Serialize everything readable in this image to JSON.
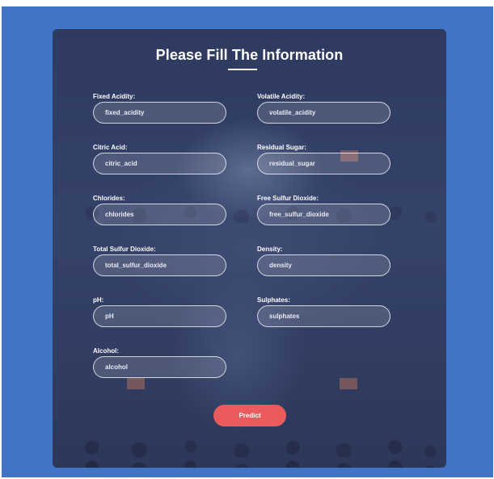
{
  "form": {
    "title": "Please Fill The Information",
    "submit_label": "Predict",
    "fields": [
      {
        "label": "Fixed Acidity:",
        "placeholder": "fixed_acidity"
      },
      {
        "label": "Volatile Acidity:",
        "placeholder": "volatile_acidity"
      },
      {
        "label": "Citric Acid:",
        "placeholder": "citric_acid"
      },
      {
        "label": "Residual Sugar:",
        "placeholder": "residual_sugar"
      },
      {
        "label": "Chlorides:",
        "placeholder": "chlorides"
      },
      {
        "label": "Free Sulfur Dioxide:",
        "placeholder": "free_sulfur_dioxide"
      },
      {
        "label": "Total Sulfur Dioxide:",
        "placeholder": "total_sulfur_dioxide"
      },
      {
        "label": "Density:",
        "placeholder": "density"
      },
      {
        "label": "pH:",
        "placeholder": "pH"
      },
      {
        "label": "Sulphates:",
        "placeholder": "sulphates"
      },
      {
        "label": "Alcohol:",
        "placeholder": "alcohol"
      }
    ]
  },
  "colors": {
    "page_background": "#4274c6",
    "card_background": "#2f3a5e",
    "button": "#ec5b5b",
    "text": "#ffffff"
  }
}
